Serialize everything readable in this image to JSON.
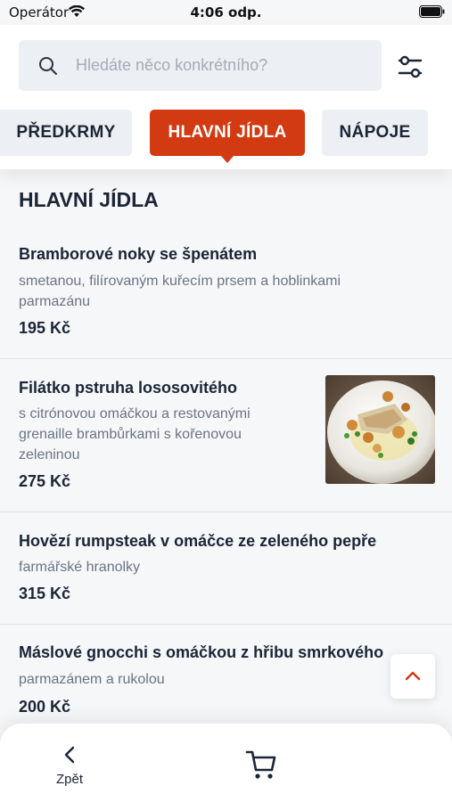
{
  "status_bar": {
    "carrier": "Operátor",
    "time": "4:06 odp."
  },
  "search": {
    "placeholder": "Hledáte něco konkrétního?",
    "value": ""
  },
  "tabs": [
    {
      "label": "PŘEDKRMY",
      "active": false
    },
    {
      "label": "HLAVNÍ JÍDLA",
      "active": true
    },
    {
      "label": "NÁPOJE",
      "active": false
    }
  ],
  "section": {
    "title": "HLAVNÍ JÍDLA"
  },
  "menu_items": [
    {
      "name": "Bramborové noky se špenátem",
      "description": "smetanou, filírovaným kuřecím prsem a hoblinkami parmazánu",
      "price": "195 Kč"
    },
    {
      "name": "Filátko pstruha lososovitého",
      "description": "s citrónovou omáčkou a restovanými grenaille brambůrkami s kořenovou zeleninou",
      "price": "275 Kč",
      "image": "dish-photo"
    },
    {
      "name": "Hovězí rumpsteak v omáčce ze zeleného pepře",
      "description": "farmářské hranolky",
      "price": "315 Kč"
    },
    {
      "name": "Máslové gnocchi s omáčkou z hřibu smrkového",
      "description": "parmazánem a rukolou",
      "price": "200 Kč"
    }
  ],
  "bottom_bar": {
    "back_label": "Zpět",
    "cart_icon": "cart-icon"
  },
  "colors": {
    "accent": "#d23a12",
    "text": "#1b2536",
    "muted": "#6b7484",
    "tab_bg": "#eceff3"
  }
}
